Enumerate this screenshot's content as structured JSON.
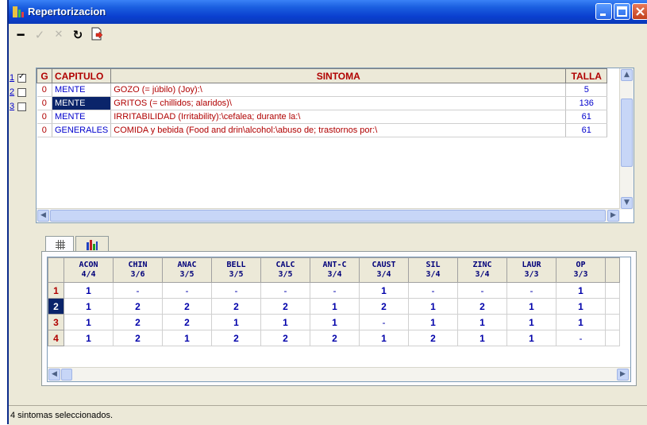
{
  "window": {
    "title": "Repertorizacion"
  },
  "toolbar": {
    "tools": [
      {
        "name": "remove-tool",
        "glyph": "━",
        "enabled": true
      },
      {
        "name": "check-tool",
        "glyph": "✓",
        "enabled": false
      },
      {
        "name": "delete-tool",
        "glyph": "✕",
        "enabled": false
      },
      {
        "name": "refresh-tool",
        "glyph": "↻",
        "enabled": true
      },
      {
        "name": "export-tool",
        "glyph": "",
        "enabled": true
      }
    ]
  },
  "symptom_checks": [
    {
      "num": "1",
      "checked": true
    },
    {
      "num": "2",
      "checked": false
    },
    {
      "num": "3",
      "checked": false
    }
  ],
  "symptoms": {
    "headers": {
      "g": "G",
      "capitulo": "CAPITULO",
      "sintoma": "SINTOMA",
      "talla": "TALLA"
    },
    "rows": [
      {
        "g": "0",
        "capitulo": "MENTE",
        "sintoma": "GOZO (= júbilo) (Joy):\\",
        "talla": "5"
      },
      {
        "g": "0",
        "capitulo": "MENTE",
        "sintoma": "GRITOS (= chillidos; alaridos)\\",
        "talla": "136"
      },
      {
        "g": "0",
        "capitulo": "MENTE",
        "sintoma": "IRRITABILIDAD (Irritability):\\cefalea; durante la:\\",
        "talla": "61"
      },
      {
        "g": "0",
        "capitulo": "GENERALES",
        "sintoma": "COMIDA y bebida (Food and drin\\alcohol:\\abuso de; trastornos por:\\",
        "talla": "61"
      }
    ]
  },
  "remedies": {
    "columns": [
      {
        "name": "ACON",
        "score": "4/4"
      },
      {
        "name": "CHIN",
        "score": "3/6"
      },
      {
        "name": "ANAC",
        "score": "3/5"
      },
      {
        "name": "BELL",
        "score": "3/5"
      },
      {
        "name": "CALC",
        "score": "3/5"
      },
      {
        "name": "ANT-C",
        "score": "3/4"
      },
      {
        "name": "CAUST",
        "score": "3/4"
      },
      {
        "name": "SIL",
        "score": "3/4"
      },
      {
        "name": "ZINC",
        "score": "3/4"
      },
      {
        "name": "LAUR",
        "score": "3/3"
      },
      {
        "name": "OP",
        "score": "3/3"
      }
    ],
    "rows": [
      {
        "num": "1",
        "values": [
          "1",
          "-",
          "-",
          "-",
          "-",
          "-",
          "1",
          "-",
          "-",
          "-",
          "1"
        ]
      },
      {
        "num": "2",
        "values": [
          "1",
          "2",
          "2",
          "2",
          "2",
          "1",
          "2",
          "1",
          "2",
          "1",
          "1"
        ]
      },
      {
        "num": "3",
        "values": [
          "1",
          "2",
          "2",
          "1",
          "1",
          "1",
          "-",
          "1",
          "1",
          "1",
          "1"
        ]
      },
      {
        "num": "4",
        "values": [
          "1",
          "2",
          "1",
          "2",
          "2",
          "2",
          "1",
          "2",
          "1",
          "1",
          "-"
        ]
      }
    ]
  },
  "status": {
    "text": "4 sintomas seleccionados."
  }
}
